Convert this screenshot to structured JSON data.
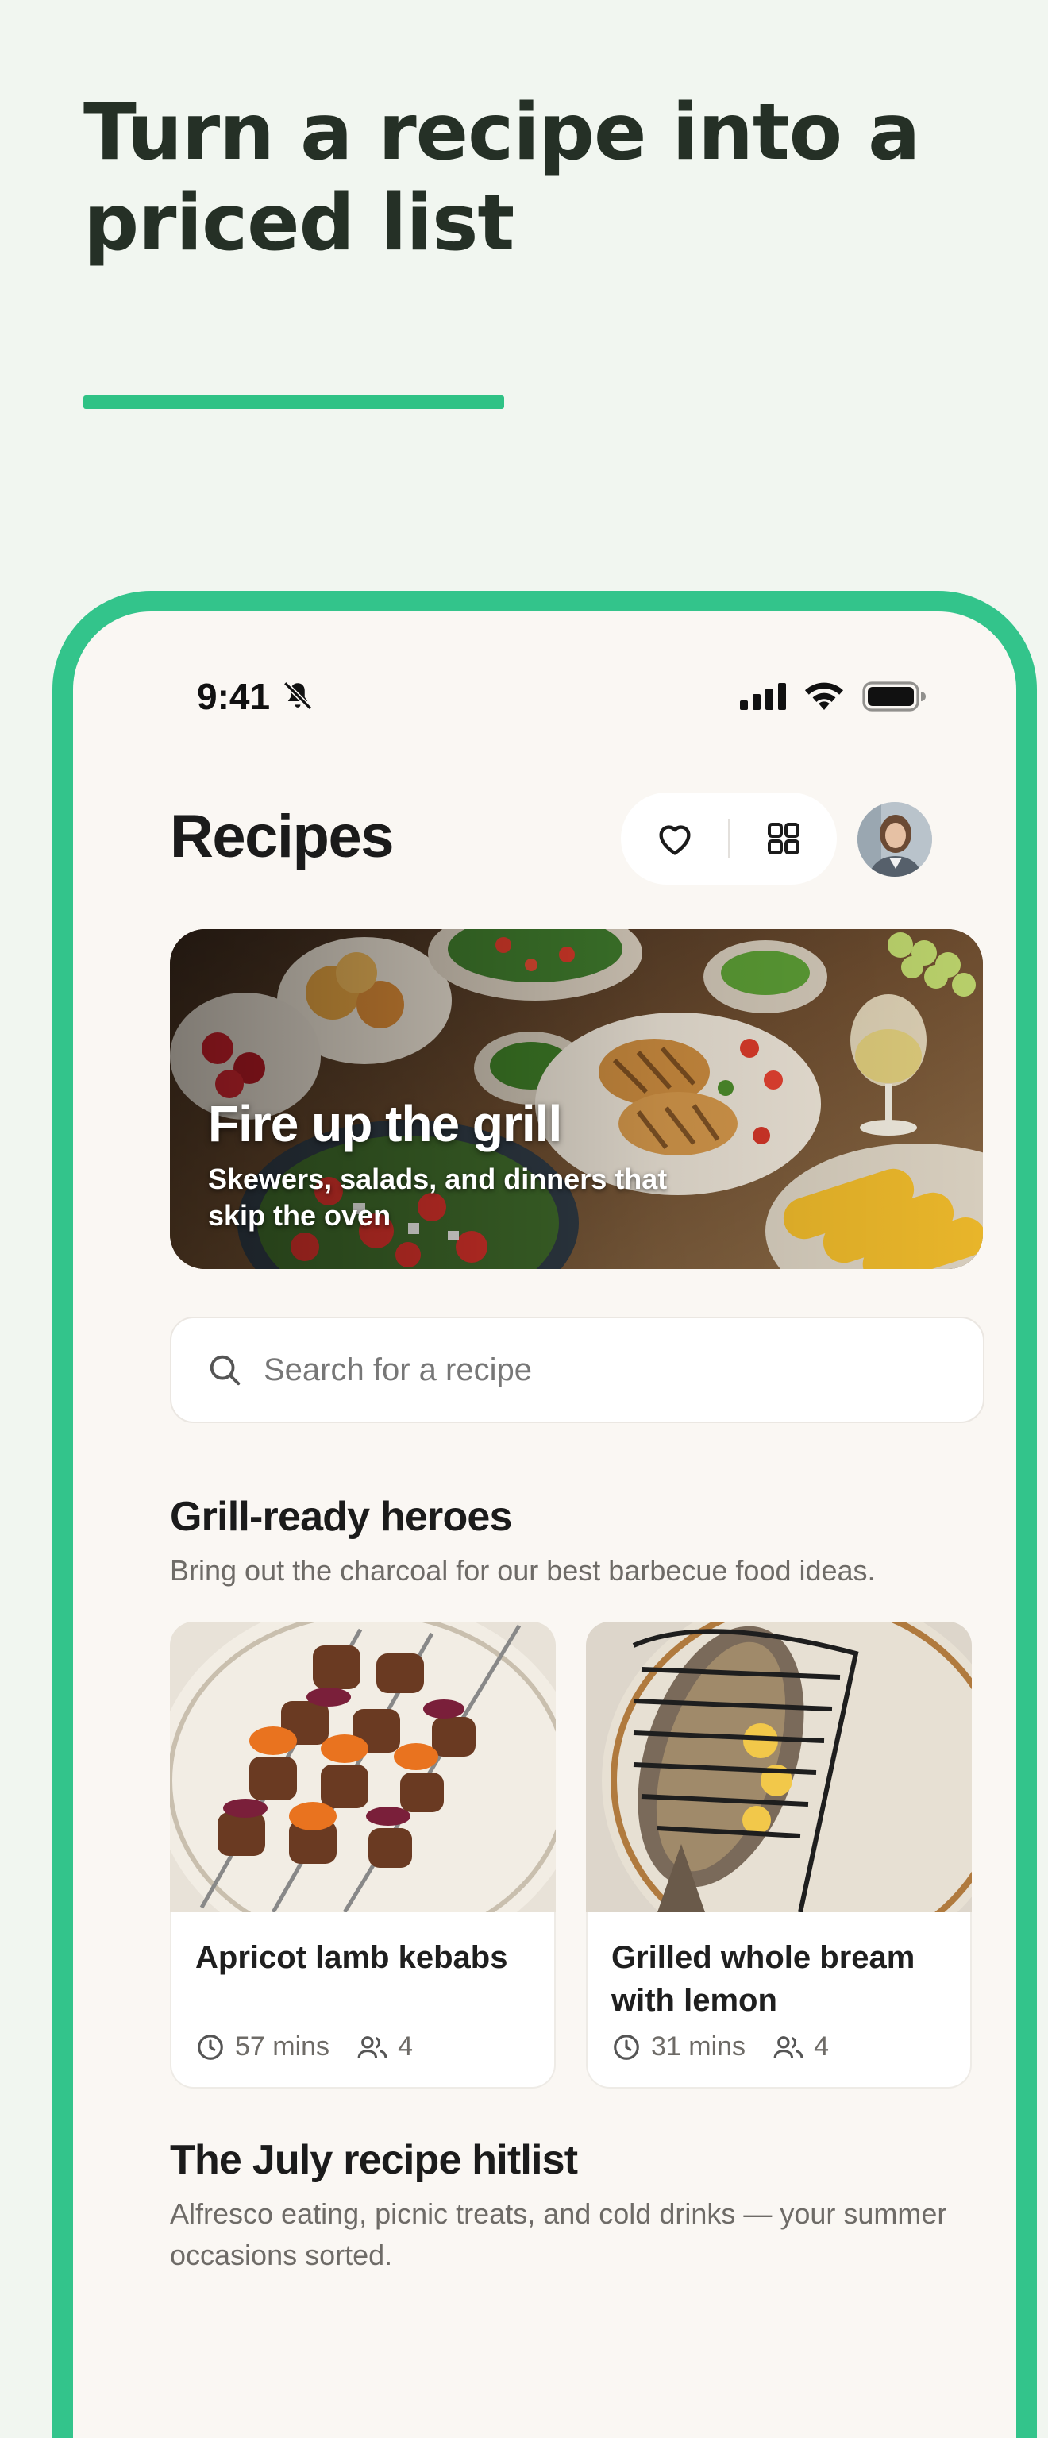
{
  "headline": "Turn a recipe into a priced list",
  "colors": {
    "accent": "#33c48b",
    "background": "#f1f6f0",
    "app_bg": "#faf7f3"
  },
  "status_bar": {
    "time": "9:41"
  },
  "header": {
    "title": "Recipes",
    "favorites_icon": "heart-icon",
    "grid_icon": "grid-icon"
  },
  "hero": {
    "title": "Fire up the grill",
    "subtitle": "Skewers, salads, and dinners that skip the oven"
  },
  "search": {
    "placeholder": "Search for a recipe"
  },
  "section1": {
    "title": "Grill-ready heroes",
    "subtitle": "Bring out the charcoal for our best barbecue food ideas.",
    "cards": [
      {
        "name": "Apricot lamb kebabs",
        "time": "57 mins",
        "servings": "4"
      },
      {
        "name": "Grilled whole bream with lemon",
        "time": "31 mins",
        "servings": "4"
      }
    ]
  },
  "section2": {
    "title": "The July recipe hitlist",
    "subtitle": "Alfresco eating, picnic treats, and cold drinks — your summer occasions sorted."
  }
}
